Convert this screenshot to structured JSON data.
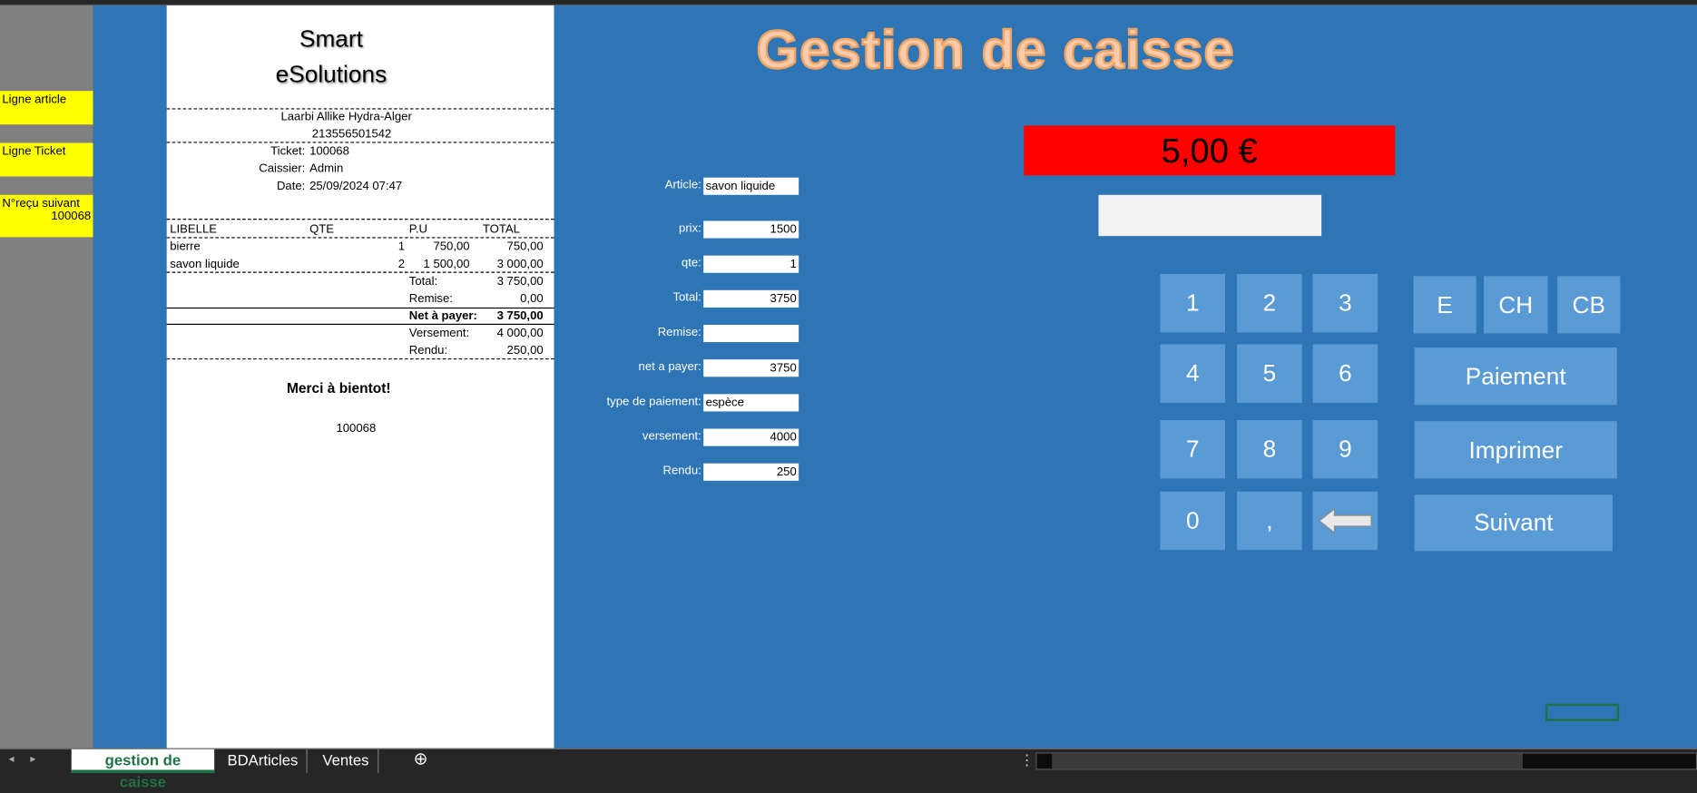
{
  "side_labels": {
    "ligne_article": "Ligne article",
    "ligne_ticket": "Ligne Ticket",
    "next_receipt_label": "N°reçu suivant",
    "next_receipt_value": "100068"
  },
  "receipt": {
    "brand_line1": "Smart",
    "brand_line2": "eSolutions",
    "address": "Laarbi Allike Hydra-Alger",
    "phone": "213556501542",
    "ticket_label": "Ticket:",
    "ticket": "100068",
    "cashier_label": "Caissier:",
    "cashier": "Admin",
    "date_label": "Date:",
    "date": "25/09/2024 07:47",
    "headers": [
      "LIBELLE",
      "QTE",
      "P.U",
      "TOTAL"
    ],
    "rows": [
      {
        "libelle": "bierre",
        "qte": "1",
        "pu": "750,00",
        "total": "750,00"
      },
      {
        "libelle": "savon liquide",
        "qte": "2",
        "pu": "1 500,00",
        "total": "3 000,00"
      }
    ],
    "total_label": "Total:",
    "total": "3 750,00",
    "remise_label": "Remise:",
    "remise": "0,00",
    "net_label": "Net à payer:",
    "net": "3 750,00",
    "versement_label": "Versement:",
    "versement": "4 000,00",
    "rendu_label": "Rendu:",
    "rendu": "250,00",
    "thanks": "Merci à bientot!",
    "footer_number": "100068"
  },
  "main": {
    "title": "Gestion de caisse",
    "display_amount": "5,00 €",
    "entry_value": "",
    "form": [
      {
        "label": "Article:",
        "value": "savon liquide",
        "align": "left"
      },
      {
        "label": "prix:",
        "value": "1500",
        "align": "right"
      },
      {
        "label": "qte:",
        "value": "1",
        "align": "right"
      },
      {
        "label": "Total:",
        "value": "3750",
        "align": "right"
      },
      {
        "label": "Remise:",
        "value": "",
        "align": "right"
      },
      {
        "label": "net a payer:",
        "value": "3750",
        "align": "right"
      },
      {
        "label": "type de paiement:",
        "value": "espèce",
        "align": "left"
      },
      {
        "label": "versement:",
        "value": "4000",
        "align": "right"
      },
      {
        "label": "Rendu:",
        "value": "250",
        "align": "right"
      }
    ],
    "keys": [
      "1",
      "2",
      "3",
      "4",
      "5",
      "6",
      "7",
      "8",
      "9",
      "0",
      ","
    ],
    "payment_types": [
      "E",
      "CH",
      "CB"
    ],
    "paiement": "Paiement",
    "imprimer": "Imprimer",
    "suivant": "Suivant"
  },
  "sheets": [
    "gestion de caisse",
    "BDArticles",
    "Ventes"
  ],
  "colors": {
    "blue": "#2e75b6",
    "button": "#5b9bd5",
    "display": "#ff0000",
    "highlight": "#ffff00"
  }
}
